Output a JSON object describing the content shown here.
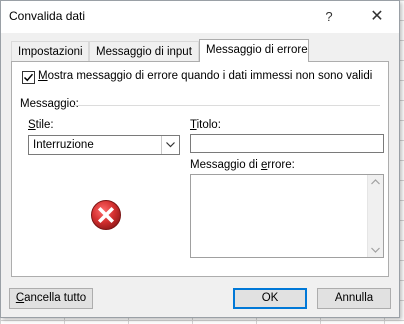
{
  "window": {
    "title": "Convalida dati",
    "help_label": "?",
    "close_label": "✕"
  },
  "tabs": [
    {
      "label": "Impostazioni",
      "active": false
    },
    {
      "label": "Messaggio di input",
      "active": false
    },
    {
      "label": "Messaggio di errore",
      "active": true
    }
  ],
  "error_tab": {
    "show_error": {
      "label": "ostra messaggio di errore quando i dati immessi non sono validi",
      "mnemonic": "M",
      "checked": true
    },
    "group_label": "Messaggio:",
    "style": {
      "label_mnemonic": "S",
      "label_rest": "tile:",
      "selected": "Interruzione"
    },
    "title": {
      "label_mnemonic": "T",
      "label_rest": "itolo:",
      "value": ""
    },
    "message": {
      "label_prefix": "Messaggio di ",
      "label_mnemonic": "e",
      "label_rest": "rrore:",
      "value": ""
    },
    "style_icon": "stop-error-icon"
  },
  "buttons": {
    "clear_mnemonic": "C",
    "clear_rest": "ancella tutto",
    "ok": "OK",
    "cancel": "Annulla"
  },
  "colors": {
    "focus_border": "#0078d7",
    "error_icon": "#d32f2f"
  }
}
